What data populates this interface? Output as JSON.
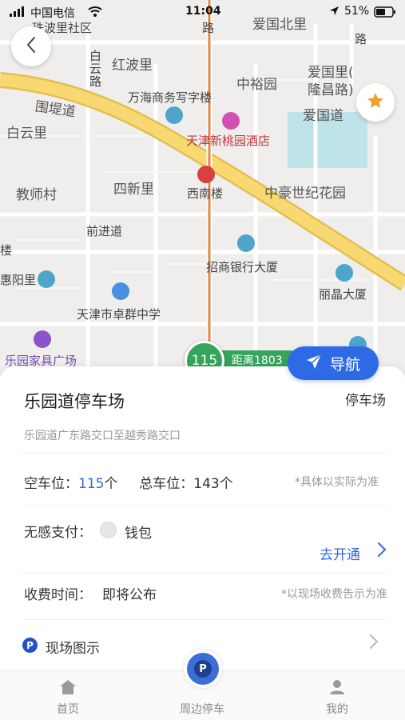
{
  "status_bar": {
    "carrier": "中国电信",
    "time": "11:04",
    "battery": "51%"
  },
  "map": {
    "labels": [
      "珠波里社区",
      "路",
      "爱国北里",
      "路",
      "红波里",
      "白云路",
      "爱国里(",
      "隆昌路)",
      "万海商务写字楼",
      "中裕园",
      "围堤道",
      "白云里",
      "爱国道",
      "天津新桃园酒店",
      "教师村",
      "四新里",
      "西南楼",
      "中豪世纪花园",
      "前进道",
      "楼",
      "招商银行大厦",
      "惠阳里",
      "丽晶大厦",
      "天津市卓群中学",
      "乐园家具广场"
    ],
    "marker_count": "115",
    "distance_text": "距离1803"
  },
  "nav_button": {
    "label": "导航"
  },
  "parking": {
    "name": "乐园道停车场",
    "type": "停车场",
    "address": "乐园道广东路交口至越秀路交口",
    "free_label": "空车位：",
    "free_value": "115",
    "unit": "个",
    "total_label": "总车位：",
    "total_value": "143",
    "availability_note": "*具体以实际为准",
    "payment_label": "无感支付：",
    "wallet_label": "钱包",
    "open_label": "去开通",
    "fee_label": "收费时间：",
    "fee_value": "即将公布",
    "fee_note": "*以现场收费告示为准",
    "site_badge": "P",
    "site_label": "现场图示"
  },
  "tab_bar": {
    "home": "首页",
    "nearby": "周边停车",
    "nearby_icon": "P",
    "mine": "我的"
  },
  "colors": {
    "accent": "#2f6ae6",
    "marker_green": "#34a55a",
    "main_road": "#f7d873",
    "rail_orange": "#e08a4a",
    "fav_star": "#f0a030"
  }
}
